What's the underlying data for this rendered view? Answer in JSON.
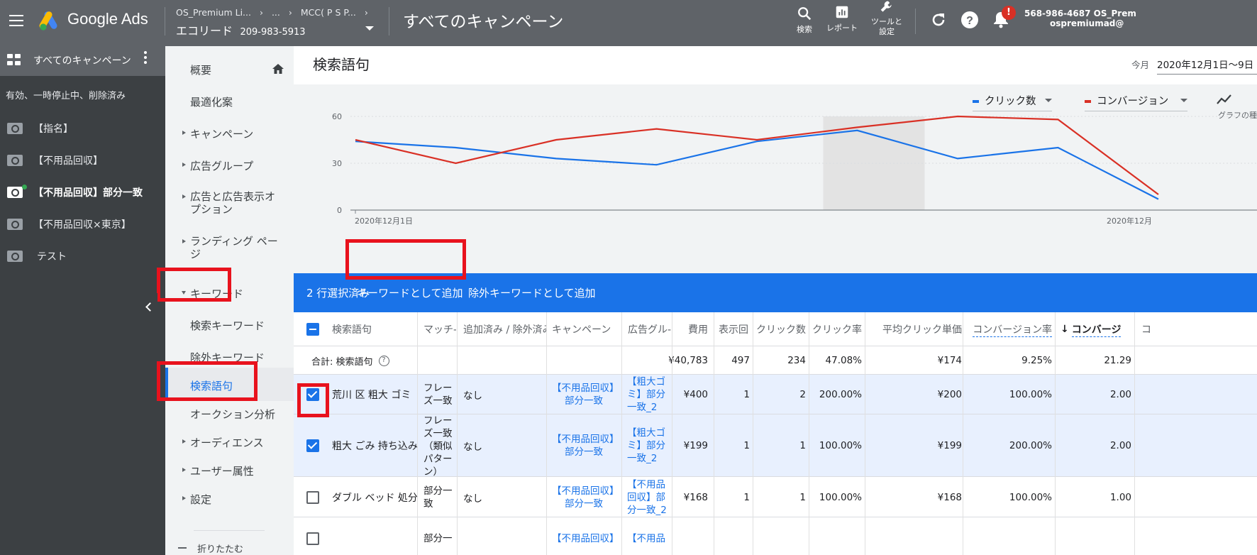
{
  "header": {
    "product_name": "Google Ads",
    "breadcrumb_account": "OS_Premium Li...",
    "breadcrumb_ellipsis": "...",
    "breadcrumb_mcc": "MCC( P S P...",
    "account_name": "エコリード",
    "account_id": "209-983-5913",
    "page_title": "すべてのキャンペーン",
    "search_label": "検索",
    "report_label": "レポート",
    "tools_label_line1": "ツールと",
    "tools_label_line2": "設定",
    "notification_badge": "!",
    "customer_id": "568-986-4687 OS_Prem",
    "user_email": "ospremiumad@"
  },
  "sidebar": {
    "title": "すべてのキャンペーン",
    "filter": "有効、一時停止中、削除済み",
    "campaigns": [
      {
        "name": "【指名】"
      },
      {
        "name": "【不用品回収】"
      },
      {
        "name": "【不用品回収】部分一致"
      },
      {
        "name": "【不用品回収×東京】"
      },
      {
        "name": "テスト"
      }
    ]
  },
  "nav": {
    "overview": "概要",
    "recommendations": "最適化案",
    "campaigns": "キャンペーン",
    "ad_groups": "広告グループ",
    "ads_line1": "広告と広告表示オ",
    "ads_line2": "プション",
    "landing_line1": "ランディング ペー",
    "landing_line2": "ジ",
    "keywords": "キーワード",
    "search_keywords": "検索キーワード",
    "negative_keywords": "除外キーワード",
    "search_terms": "検索語句",
    "auction_insights": "オークション分析",
    "audiences": "オーディエンス",
    "demographics": "ユーザー属性",
    "settings": "設定",
    "collapse": "折りたたむ"
  },
  "main": {
    "title": "検索語句",
    "date_prefix": "今月",
    "date_range": "2020年12月1日〜9日",
    "graph_type_label": "グラフの種"
  },
  "chart_data": {
    "type": "line",
    "x": [
      "2020-12-01",
      "2020-12-02",
      "2020-12-03",
      "2020-12-04",
      "2020-12-05",
      "2020-12-06",
      "2020-12-07",
      "2020-12-08",
      "2020-12-09"
    ],
    "x_tick_labels": [
      "2020年12月1日",
      "2020年12月"
    ],
    "y_ticks": [
      "0",
      "30",
      "60"
    ],
    "ylim": [
      0,
      60
    ],
    "highlight_x": [
      "2020-12-06"
    ],
    "series": [
      {
        "name": "クリック数",
        "color": "#1a73e8",
        "values": [
          44,
          40,
          33,
          29,
          44,
          51,
          33,
          40,
          7
        ]
      },
      {
        "name": "コンバージョン",
        "color": "#d93025",
        "values": [
          45,
          30,
          45,
          52,
          45,
          53,
          60,
          58,
          10
        ]
      }
    ]
  },
  "selection_bar": {
    "count_text": "2 行選択済み",
    "add_as_keyword": "キーワードとして追加",
    "add_as_negative": "除外キーワードとして追加"
  },
  "table": {
    "columns": [
      "検索語句",
      "マッチ-",
      "追加済み / 除外済み",
      "キャンペーン",
      "広告グル-",
      "費用",
      "表示回",
      "クリック数",
      "クリック率",
      "平均クリック単価",
      "コンバージョン率",
      "コンバージ",
      "コ"
    ],
    "sort_arrow": "↓",
    "total": {
      "label": "合計: 検索語句",
      "help": "?",
      "cost": "¥40,783",
      "impressions": "497",
      "clicks": "234",
      "ctr": "47.08%",
      "cpc": "¥174",
      "conv_rate": "9.25%",
      "conversions": "21.29"
    },
    "rows": [
      {
        "term": "荒川 区 粗大 ゴミ",
        "match": [
          "フレー",
          "ズ一致"
        ],
        "added": "なし",
        "campaign": [
          "【不用品回収】",
          "部分一致"
        ],
        "adgroup": [
          "【粗大ゴ",
          "ミ】部分",
          "一致_2"
        ],
        "cost": "¥400",
        "impr": "1",
        "clicks": "2",
        "ctr": "200.00%",
        "cpc": "¥200",
        "conv_rate": "100.00%",
        "conv": "2.00",
        "checked": true
      },
      {
        "term": "粗大 ごみ 持ち込み",
        "match": [
          "フレー",
          "ズ一致",
          "（類似",
          "パター",
          "ン）"
        ],
        "added": "なし",
        "campaign": [
          "【不用品回収】",
          "部分一致"
        ],
        "adgroup": [
          "【粗大ゴ",
          "ミ】部分",
          "一致_2"
        ],
        "cost": "¥199",
        "impr": "1",
        "clicks": "1",
        "ctr": "100.00%",
        "cpc": "¥199",
        "conv_rate": "200.00%",
        "conv": "2.00",
        "checked": true
      },
      {
        "term": "ダブル ベッド 処分",
        "match": [
          "部分一",
          "致"
        ],
        "added": "なし",
        "campaign": [
          "【不用品回収】",
          "部分一致"
        ],
        "adgroup": [
          "【不用品",
          "回収】部",
          "分一致_2"
        ],
        "cost": "¥168",
        "impr": "1",
        "clicks": "1",
        "ctr": "100.00%",
        "cpc": "¥168",
        "conv_rate": "100.00%",
        "conv": "1.00",
        "checked": false
      },
      {
        "term": "",
        "match": [
          "部分一"
        ],
        "added": "",
        "campaign": [
          "【不用品回収】"
        ],
        "adgroup": [
          "【不用品"
        ],
        "cost": "",
        "impr": "",
        "clicks": "",
        "ctr": "",
        "cpc": "",
        "conv_rate": "",
        "conv": "",
        "checked": false
      }
    ]
  },
  "colors": {
    "topbar": "#5f6368",
    "sidebar": "#3c4043",
    "accent": "#1a73e8",
    "highlight_box": "#e8121d",
    "clicks_line": "#1a73e8",
    "conversions_line": "#d93025"
  }
}
